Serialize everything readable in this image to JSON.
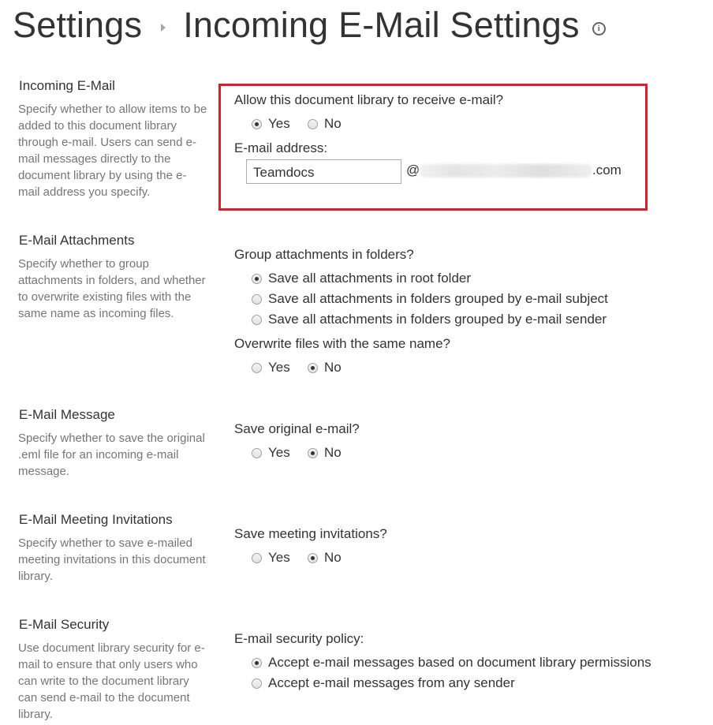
{
  "header": {
    "breadcrumb_root": "Settings",
    "page_title": "Incoming E-Mail Settings",
    "info_icon": "info-icon"
  },
  "incoming": {
    "title": "Incoming E-Mail",
    "description": "Specify whether to allow items to be added to this document library through e-mail. Users can send e-mail messages directly to the document library by using the e-mail address you specify.",
    "question": "Allow this document library to receive e-mail?",
    "yes": "Yes",
    "no": "No",
    "selected": "Yes",
    "address_label": "E-mail address:",
    "address_value": "Teamdocs",
    "at": "@",
    "domain_suffix": ".com",
    "highlight_color": "#d7202b"
  },
  "attachments": {
    "title": "E-Mail Attachments",
    "description": "Specify whether to group attachments in folders, and whether to overwrite existing files with the same name as incoming files.",
    "group_question": "Group attachments in folders?",
    "group_options": [
      "Save all attachments in root folder",
      "Save all attachments in folders grouped by e-mail subject",
      "Save all attachments in folders grouped by e-mail sender"
    ],
    "group_selected": "Save all attachments in root folder",
    "overwrite_question": "Overwrite files with the same name?",
    "yes": "Yes",
    "no": "No",
    "overwrite_selected": "No"
  },
  "message": {
    "title": "E-Mail Message",
    "description": "Specify whether to save the original .eml file for an incoming e-mail message.",
    "question": "Save original e-mail?",
    "yes": "Yes",
    "no": "No",
    "selected": "No"
  },
  "meetings": {
    "title": "E-Mail Meeting Invitations",
    "description": "Specify whether to save e-mailed meeting invitations in this document library.",
    "question": "Save meeting invitations?",
    "yes": "Yes",
    "no": "No",
    "selected": "No"
  },
  "security": {
    "title": "E-Mail Security",
    "description": "Use document library security for e-mail to ensure that only users who can write to the document library can send e-mail to the document library.",
    "question": "E-mail security policy:",
    "options": [
      "Accept e-mail messages based on document library permissions",
      "Accept e-mail messages from any sender"
    ],
    "selected": "Accept e-mail messages based on document library permissions"
  }
}
